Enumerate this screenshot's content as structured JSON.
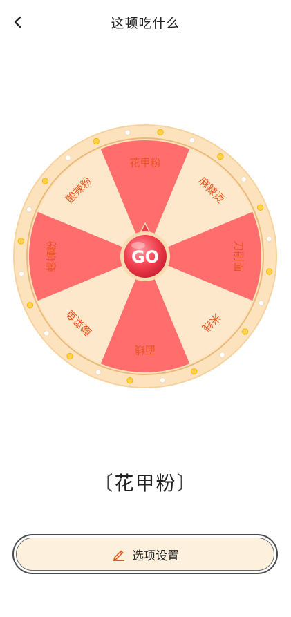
{
  "header": {
    "title": "这顿吃什么",
    "back_icon": "chevron-left-icon"
  },
  "wheel": {
    "center_label": "GO",
    "segments": [
      {
        "label": "花甲粉",
        "color": "#ff6d6d"
      },
      {
        "label": "麻辣烫",
        "color": "#fde8cc"
      },
      {
        "label": "刀削面",
        "color": "#ff6d6d"
      },
      {
        "label": "米线",
        "color": "#fde8cc"
      },
      {
        "label": "面线",
        "color": "#ff6d6d"
      },
      {
        "label": "酸菜鱼",
        "color": "#fde8cc"
      },
      {
        "label": "螺蛳粉",
        "color": "#ff6d6d"
      },
      {
        "label": "酸辣粉",
        "color": "#fde8cc"
      }
    ],
    "label_color": "#e8541e",
    "rim_color": "#fde3bd"
  },
  "result": {
    "open_bracket": "〔",
    "value": "花甲粉",
    "close_bracket": "〕"
  },
  "settings_button": {
    "label": "选项设置",
    "icon": "pencil-icon"
  }
}
